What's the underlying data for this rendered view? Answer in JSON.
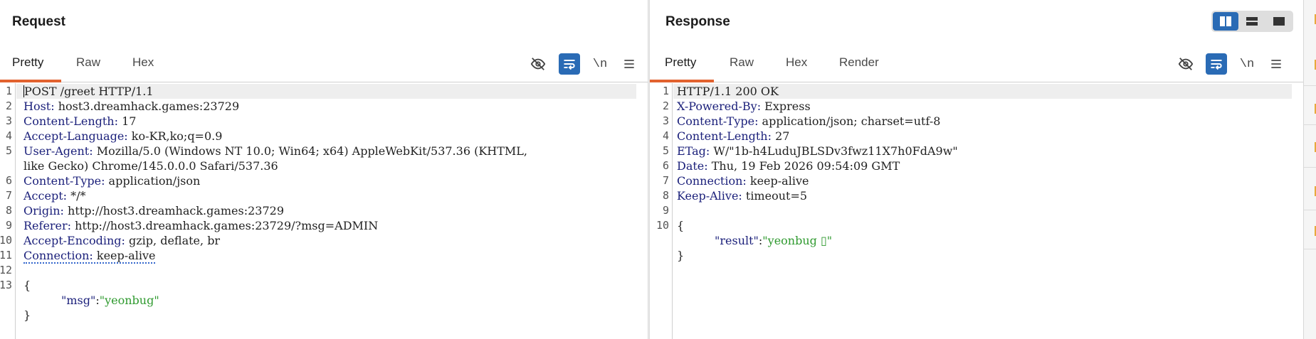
{
  "request": {
    "title": "Request",
    "tabs": [
      "Pretty",
      "Raw",
      "Hex"
    ],
    "toolbar_icons": [
      "eye-off-icon",
      "wrap-icon",
      "newline-icon",
      "menu-icon"
    ],
    "newline_label": "\\n",
    "line_numbers": [
      "1",
      "2",
      "3",
      "4",
      "5",
      "",
      "6",
      "7",
      "8",
      "9",
      "10",
      "11",
      "12",
      "13",
      "",
      ""
    ],
    "lines": {
      "l1_text": "POST /greet HTTP/1.1",
      "l2_key": "Host:",
      "l2_val": " host3.dreamhack.games:23729",
      "l3_key": "Content-Length:",
      "l3_val": " 17",
      "l4_key": "Accept-Language:",
      "l4_val": " ko-KR,ko;q=0.9",
      "l5_key": "User-Agent:",
      "l5_val": " Mozilla/5.0 (Windows NT 10.0; Win64; x64) AppleWebKit/537.36 (KHTML,",
      "l5b_val": "like Gecko) Chrome/145.0.0.0 Safari/537.36",
      "l6_key": "Content-Type:",
      "l6_val": " application/json",
      "l7_key": "Accept:",
      "l7_val": " */*",
      "l8_key": "Origin:",
      "l8_val": " http://host3.dreamhack.games:23729",
      "l9_key": "Referer:",
      "l9_val": " http://host3.dreamhack.games:23729/?msg=ADMIN",
      "l10_key": "Accept-Encoding:",
      "l10_val": " gzip, deflate, br",
      "l11_key": "Connection:",
      "l11_val": " keep-alive",
      "l13_text": "{",
      "l14_key": "\"msg\"",
      "l14_colon": ":",
      "l14_val": "\"yeonbug\"",
      "l15_text": "}"
    }
  },
  "response": {
    "title": "Response",
    "tabs": [
      "Pretty",
      "Raw",
      "Hex",
      "Render"
    ],
    "toolbar_icons": [
      "eye-off-icon",
      "wrap-icon",
      "newline-icon",
      "menu-icon"
    ],
    "newline_label": "\\n",
    "line_numbers": [
      "1",
      "2",
      "3",
      "4",
      "5",
      "6",
      "7",
      "8",
      "9",
      "10",
      "",
      ""
    ],
    "lines": {
      "l1_text": "HTTP/1.1 200 OK",
      "l2_key": "X-Powered-By:",
      "l2_val": " Express",
      "l3_key": "Content-Type:",
      "l3_val": " application/json; charset=utf-8",
      "l4_key": "Content-Length:",
      "l4_val": " 27",
      "l5_key": "ETag:",
      "l5_val": " W/\"1b-h4LuduJBLSDv3fwz11X7h0FdA9w\"",
      "l6_key": "Date:",
      "l6_val": " Thu, 19 Feb 2026 09:54:09 GMT",
      "l7_key": "Connection:",
      "l7_val": " keep-alive",
      "l8_key": "Keep-Alive:",
      "l8_val": " timeout=5",
      "l10_text": "{",
      "l11_key": "\"result\"",
      "l11_colon": ":",
      "l11_val": "\"yeonbug ▯\"",
      "l12_text": "}"
    }
  },
  "layout_toggle": {
    "options": [
      "split-horizontal-icon",
      "split-vertical-icon",
      "single-panel-icon"
    ],
    "selected": "split-horizontal-icon"
  },
  "colors": {
    "accent_tab": "#e2622f",
    "toggle_active": "#2a6bb5",
    "header_key": "#1a1f7a",
    "json_string": "#2f9a2f"
  }
}
